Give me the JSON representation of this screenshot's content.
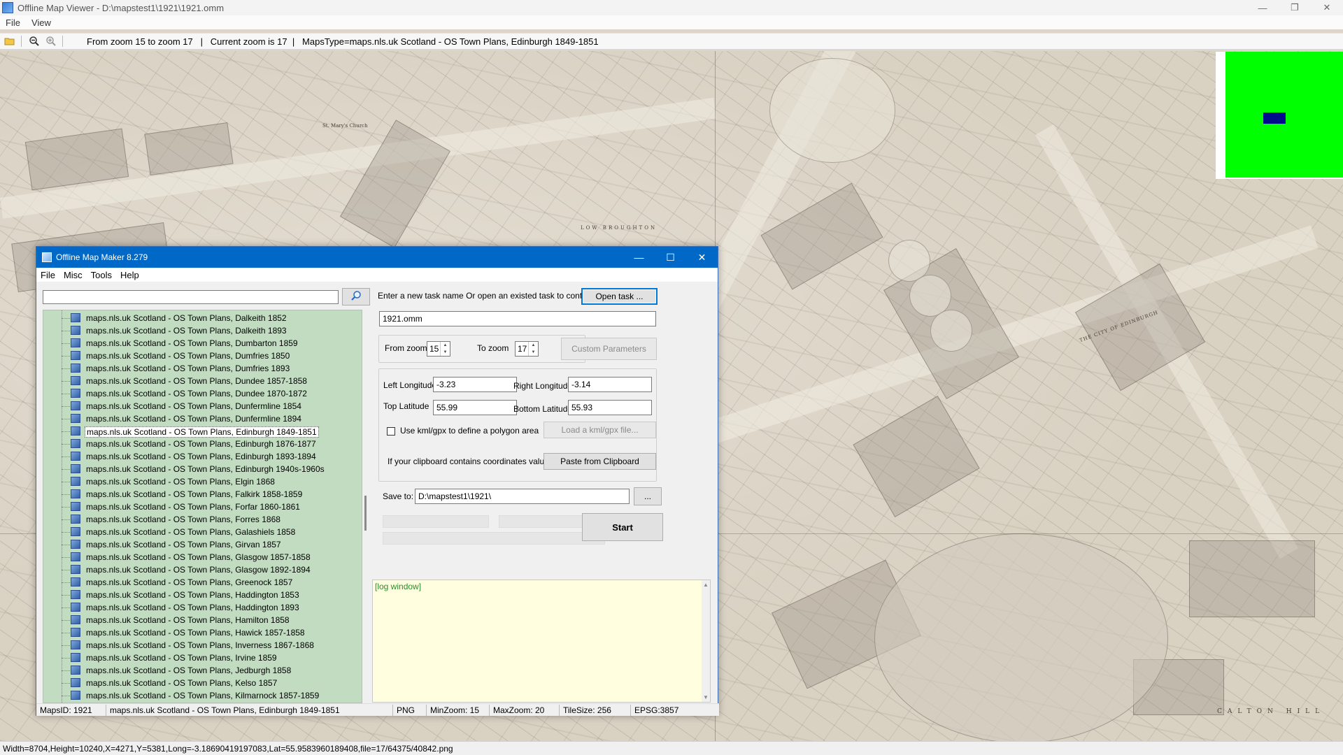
{
  "window": {
    "title": "Offline Map Viewer - D:\\mapstest1\\1921\\1921.omm",
    "controls": {
      "minimize": "—",
      "restore": "❐",
      "close": "✕"
    }
  },
  "menu": [
    "File",
    "View"
  ],
  "toolbar": {
    "info": "From zoom 15 to zoom 17   |   Current zoom is 17  |   MapsType=maps.nls.uk Scotland - OS Town Plans, Edinburgh 1849-1851"
  },
  "map_labels": {
    "church": "St. Mary's Church",
    "street": "LOW BROUGHTON",
    "city": "THE CITY OF EDINBURGH",
    "hill": "CALTON HILL"
  },
  "status": "Width=8704,Height=10240,X=4271,Y=5381,Long=-3.18690419197083,Lat=55.9583960189408,file=17/64375/40842.png",
  "dialog": {
    "title": "Offline Map Maker 8.279",
    "controls": {
      "minimize": "—",
      "maximize": "☐",
      "close": "✕"
    },
    "menu": [
      "File",
      "Misc",
      "Tools",
      "Help"
    ],
    "search": {
      "value": ""
    },
    "tree_items": [
      "maps.nls.uk Scotland - OS Town Plans, Dalkeith 1852",
      "maps.nls.uk Scotland - OS Town Plans, Dalkeith 1893",
      "maps.nls.uk Scotland - OS Town Plans, Dumbarton 1859",
      "maps.nls.uk Scotland - OS Town Plans, Dumfries 1850",
      "maps.nls.uk Scotland - OS Town Plans, Dumfries 1893",
      "maps.nls.uk Scotland - OS Town Plans, Dundee 1857-1858",
      "maps.nls.uk Scotland - OS Town Plans, Dundee 1870-1872",
      "maps.nls.uk Scotland - OS Town Plans, Dunfermline 1854",
      "maps.nls.uk Scotland - OS Town Plans, Dunfermline 1894",
      "maps.nls.uk Scotland - OS Town Plans, Edinburgh 1849-1851",
      "maps.nls.uk Scotland - OS Town Plans, Edinburgh 1876-1877",
      "maps.nls.uk Scotland - OS Town Plans, Edinburgh 1893-1894",
      "maps.nls.uk Scotland - OS Town Plans, Edinburgh 1940s-1960s",
      "maps.nls.uk Scotland - OS Town Plans, Elgin 1868",
      "maps.nls.uk Scotland - OS Town Plans, Falkirk 1858-1859",
      "maps.nls.uk Scotland - OS Town Plans, Forfar 1860-1861",
      "maps.nls.uk Scotland - OS Town Plans, Forres 1868",
      "maps.nls.uk Scotland - OS Town Plans, Galashiels 1858",
      "maps.nls.uk Scotland - OS Town Plans, Girvan 1857",
      "maps.nls.uk Scotland - OS Town Plans, Glasgow 1857-1858",
      "maps.nls.uk Scotland - OS Town Plans, Glasgow 1892-1894",
      "maps.nls.uk Scotland - OS Town Plans, Greenock 1857",
      "maps.nls.uk Scotland - OS Town Plans, Haddington 1853",
      "maps.nls.uk Scotland - OS Town Plans, Haddington 1893",
      "maps.nls.uk Scotland - OS Town Plans, Hamilton 1858",
      "maps.nls.uk Scotland - OS Town Plans, Hawick 1857-1858",
      "maps.nls.uk Scotland - OS Town Plans, Inverness 1867-1868",
      "maps.nls.uk Scotland - OS Town Plans, Irvine 1859",
      "maps.nls.uk Scotland - OS Town Plans, Jedburgh 1858",
      "maps.nls.uk Scotland - OS Town Plans, Kelso 1857",
      "maps.nls.uk Scotland - OS Town Plans, Kilmarnock 1857-1859"
    ],
    "selected_item": "maps.nls.uk Scotland - OS Town Plans, Edinburgh 1849-1851",
    "task_prompt": "Enter a new task name Or open an existed task to continue:",
    "open_task_label": "Open task ...",
    "task_name": "1921.omm",
    "from_zoom_label": "From zoom",
    "from_zoom": "15",
    "to_zoom_label": "To zoom",
    "to_zoom": "17",
    "custom_params_label": "Custom Parameters",
    "left_lon_label": "Left Longitude",
    "left_lon": "-3.23",
    "right_lon_label": "Right Longitude",
    "right_lon": "-3.14",
    "top_lat_label": "Top Latitude",
    "top_lat": "55.99",
    "bottom_lat_label": "Bottom Latitude",
    "bottom_lat": "55.93",
    "kml_checkbox_label": "Use kml/gpx to define a polygon area",
    "kml_checked": false,
    "load_kml_label": "Load a kml/gpx file...",
    "clipboard_prompt": "If your clipboard contains coordinates values:",
    "paste_label": "Paste from Clipboard",
    "save_to_label": "Save to:",
    "save_to": "D:\\mapstest1\\1921\\",
    "browse_label": "...",
    "start_label": "Start",
    "log_text": "[log window]",
    "status": {
      "maps_id": "MapsID: 1921",
      "maps_name": "maps.nls.uk Scotland - OS Town Plans, Edinburgh 1849-1851",
      "format": "PNG",
      "min_zoom": "MinZoom: 15",
      "max_zoom": "MaxZoom: 20",
      "tile_size": "TileSize: 256",
      "epsg": "EPSG:3857"
    }
  }
}
